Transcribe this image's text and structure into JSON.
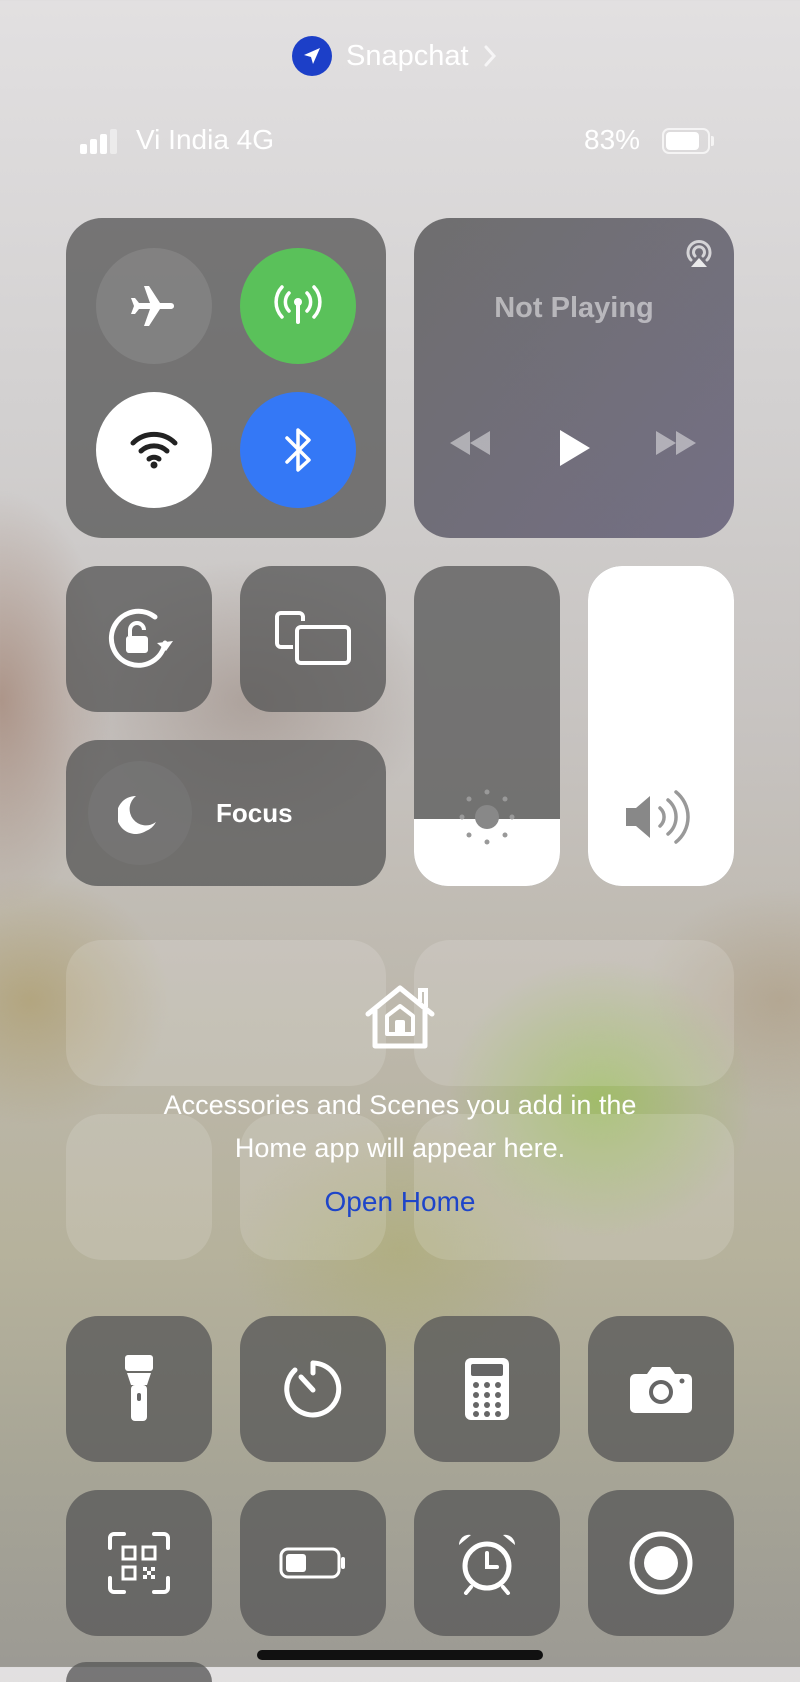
{
  "breadcrumb": {
    "app_name": "Snapchat"
  },
  "status_bar": {
    "carrier": "Vi India 4G",
    "battery_percent": "83%",
    "battery_level": 0.83
  },
  "connectivity": {
    "airplane_mode": false,
    "cellular_data": true,
    "wifi": true,
    "bluetooth": true
  },
  "media": {
    "status": "Not Playing"
  },
  "focus": {
    "label": "Focus"
  },
  "brightness": {
    "level": 0.21
  },
  "volume": {
    "level": 1.0
  },
  "home": {
    "message_line1": "Accessories and Scenes you add in the",
    "message_line2": "Home app will appear here.",
    "open_link": "Open Home"
  },
  "colors": {
    "accent_green": "#5ac15a",
    "accent_blue": "#3478f6",
    "link_blue": "#1e45c9"
  },
  "icons": [
    "location-arrow-icon",
    "airplane-icon",
    "cellular-antenna-icon",
    "wifi-icon",
    "bluetooth-icon",
    "airplay-icon",
    "rewind-icon",
    "play-icon",
    "fast-forward-icon",
    "orientation-lock-icon",
    "screen-mirroring-icon",
    "moon-icon",
    "sun-icon",
    "speaker-icon",
    "home-icon",
    "flashlight-icon",
    "timer-icon",
    "calculator-icon",
    "camera-icon",
    "qr-scanner-icon",
    "low-power-battery-icon",
    "alarm-icon",
    "screen-record-icon"
  ]
}
